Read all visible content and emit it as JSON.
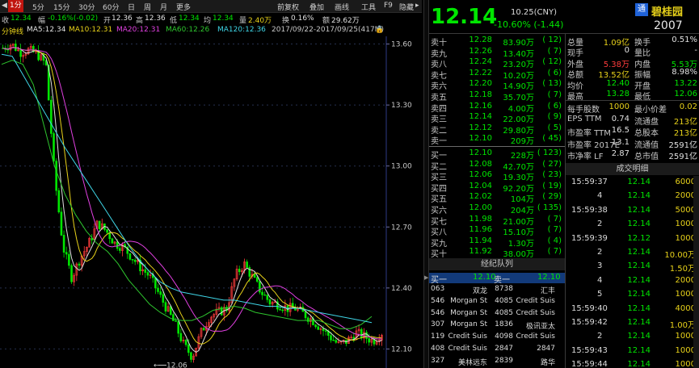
{
  "menu": {
    "items": [
      "1分",
      "5分",
      "15分",
      "30分",
      "60分",
      "日",
      "周",
      "月",
      "更多"
    ],
    "active_index": 0,
    "right_items": [
      "前复权",
      "叠加",
      "画线",
      "工具",
      "F9",
      "隐藏"
    ]
  },
  "info": {
    "close_label": "收",
    "close_value": "12.34",
    "change_label": "幅",
    "change_value": "-0.16%(-0.02)",
    "open_label": "开",
    "open_value": "12.36",
    "high_label": "高",
    "high_value": "12.36",
    "low_label": "低",
    "low_value": "12.34",
    "avg_label": "均",
    "avg_value": "12.34",
    "vol_label": "量",
    "vol_value": "2.40万",
    "turn_label": "换",
    "turn_value": "0.16%",
    "amt_label": "额",
    "amt_value": "29.62万"
  },
  "ma": {
    "title": "分钟线",
    "ma5": "MA5:12.34",
    "ma10": "MA10:12.31",
    "ma20": "MA20:12.31",
    "ma60": "MA60:12.26",
    "ma120": "MA120:12.36",
    "range": "2017/09/22-2017/09/25(417M)"
  },
  "colors": {
    "ma5": "#e0e0e0",
    "ma10": "#e8d21a",
    "ma20": "#e040e0",
    "ma60": "#2ec52e",
    "ma120": "#3fd5e6",
    "up": "#ff3c3c",
    "down": "#00e600"
  },
  "chart_data": {
    "type": "candlestick",
    "timeframe": "1分",
    "y_ticks": [
      "13.60",
      "13.30",
      "13.00",
      "12.70",
      "12.40",
      "12.10"
    ],
    "ylim": [
      12.05,
      13.63
    ],
    "low_annotation": "12.06",
    "low_value": 12.06,
    "approx_close_series": [
      13.58,
      13.6,
      13.56,
      13.57,
      13.55,
      13.5,
      12.95,
      12.6,
      12.45,
      12.55,
      12.62,
      12.72,
      12.68,
      12.62,
      12.6,
      12.55,
      12.5,
      12.46,
      12.38,
      12.3,
      12.22,
      12.12,
      12.06,
      12.18,
      12.26,
      12.28,
      12.3,
      12.46,
      12.52,
      12.45,
      12.38,
      12.33,
      12.32,
      12.3,
      12.3,
      12.27,
      12.24,
      12.2,
      12.16,
      12.12,
      12.14,
      12.18,
      12.16,
      12.14,
      12.18
    ],
    "ma60_series": [
      13.5,
      13.52,
      13.5,
      13.4,
      13.2,
      13.0,
      12.86,
      12.76,
      12.68,
      12.62,
      12.58,
      12.52,
      12.44,
      12.38,
      12.32,
      12.28,
      12.25,
      12.24,
      12.24,
      12.26,
      12.29,
      12.3,
      12.31,
      12.3,
      12.28,
      12.27,
      12.26,
      12.25,
      12.24,
      12.24,
      12.24,
      12.22,
      12.2,
      12.2,
      12.22,
      12.26
    ],
    "ma120_series": [
      13.55,
      13.54,
      13.45,
      13.36,
      13.27,
      13.18,
      13.09,
      13.01,
      12.93,
      12.85,
      12.77,
      12.69,
      12.61,
      12.54,
      12.48,
      12.43,
      12.4,
      12.38,
      12.37,
      12.36,
      12.35,
      12.34,
      12.34,
      12.33,
      12.32,
      12.31,
      12.31,
      12.3,
      12.3,
      12.29,
      12.28,
      12.27,
      12.26,
      12.25,
      12.24,
      12.23
    ]
  },
  "quote": {
    "price": "12.14",
    "date": "10.25(CNY)",
    "change": "-10.60% (-1.44)",
    "badge": "通",
    "name": "碧桂园",
    "code": "2007"
  },
  "order_book": {
    "asks": [
      {
        "label": "卖十",
        "price": "12.28",
        "vol": "83.90万",
        "cnt": "( 12)"
      },
      {
        "label": "卖九",
        "price": "12.26",
        "vol": "13.40万",
        "cnt": "( 7)"
      },
      {
        "label": "卖八",
        "price": "12.24",
        "vol": "23.20万",
        "cnt": "( 12)"
      },
      {
        "label": "卖七",
        "price": "12.22",
        "vol": "10.20万",
        "cnt": "( 6)"
      },
      {
        "label": "卖六",
        "price": "12.20",
        "vol": "14.90万",
        "cnt": "( 13)"
      },
      {
        "label": "卖五",
        "price": "12.18",
        "vol": "35.70万",
        "cnt": "( 7)"
      },
      {
        "label": "卖四",
        "price": "12.16",
        "vol": "4.00万",
        "cnt": "( 6)"
      },
      {
        "label": "卖三",
        "price": "12.14",
        "vol": "22.00万",
        "cnt": "( 9)"
      },
      {
        "label": "卖二",
        "price": "12.12",
        "vol": "29.80万",
        "cnt": "( 5)"
      },
      {
        "label": "卖一",
        "price": "12.10",
        "vol": "209万",
        "cnt": "( 45)"
      }
    ],
    "bids": [
      {
        "label": "买一",
        "price": "12.10",
        "vol": "228万",
        "cnt": "( 123)"
      },
      {
        "label": "买二",
        "price": "12.08",
        "vol": "42.70万",
        "cnt": "( 27)"
      },
      {
        "label": "买三",
        "price": "12.06",
        "vol": "19.30万",
        "cnt": "( 23)"
      },
      {
        "label": "买四",
        "price": "12.04",
        "vol": "92.20万",
        "cnt": "( 19)"
      },
      {
        "label": "买五",
        "price": "12.02",
        "vol": "104万",
        "cnt": "( 29)"
      },
      {
        "label": "买六",
        "price": "12.00",
        "vol": "204万",
        "cnt": "( 135)"
      },
      {
        "label": "买七",
        "price": "11.98",
        "vol": "21.00万",
        "cnt": "( 7)"
      },
      {
        "label": "买八",
        "price": "11.96",
        "vol": "15.10万",
        "cnt": "( 7)"
      },
      {
        "label": "买九",
        "price": "11.94",
        "vol": "1.30万",
        "cnt": "( 4)"
      },
      {
        "label": "买十",
        "price": "11.92",
        "vol": "38.00万",
        "cnt": "( 7)"
      }
    ]
  },
  "stats": [
    {
      "l1": "总量",
      "v1": "1.09亿",
      "c1": "yellow",
      "l2": "换手",
      "v2": "0.51%",
      "c2": "white"
    },
    {
      "l1": "现手",
      "v1": "0",
      "c1": "white",
      "l2": "量比",
      "v2": "-",
      "c2": "white"
    },
    {
      "l1": "外盘",
      "v1": "5.38万",
      "c1": "red",
      "l2": "内盘",
      "v2": "5.53万",
      "c2": "green"
    },
    {
      "l1": "总额",
      "v1": "13.52亿",
      "c1": "yellow",
      "l2": "振幅",
      "v2": "8.98%",
      "c2": "white"
    },
    {
      "l1": "均价",
      "v1": "12.40",
      "c1": "green",
      "l2": "开盘",
      "v2": "13.22",
      "c2": "green"
    },
    {
      "l1": "最高",
      "v1": "13.28",
      "c1": "green",
      "l2": "最低",
      "v2": "12.06",
      "c2": "green"
    }
  ],
  "stats2": [
    {
      "l1": "每手股数",
      "v1": "1000",
      "c1": "yellow",
      "l2": "最小价差",
      "v2": "0.02",
      "c2": "yellow"
    },
    {
      "l1": "EPS TTM",
      "v1": "0.74",
      "c1": "white",
      "l2": "流通盘",
      "v2": "213亿",
      "c2": "yellow"
    },
    {
      "l1": "市盈率 TTM",
      "v1": "16.5",
      "c1": "white",
      "l2": "总股本",
      "v2": "213亿",
      "c2": "yellow"
    },
    {
      "l1": "市盈率 2017E",
      "v1": "13.1",
      "c1": "white",
      "l2": "流通值",
      "v2": "2591亿",
      "c2": "white"
    },
    {
      "l1": "市净率 LF",
      "v1": "2.87",
      "c1": "white",
      "l2": "总市值",
      "v2": "2591亿",
      "c2": "white"
    }
  ],
  "broker_title": "经纪队列",
  "broker_header": {
    "left": "买一",
    "left_price": "12.10",
    "right": "卖一",
    "right_price": "12.10"
  },
  "brokers": [
    {
      "id": "063",
      "name": "双龙",
      "num": "8738",
      "name2": "汇丰"
    },
    {
      "id": "546",
      "name": "Morgan St",
      "num": "4085",
      "name2": "Credit Suis"
    },
    {
      "id": "546",
      "name": "Morgan St",
      "num": "4085",
      "name2": "Credit Suis"
    },
    {
      "id": "307",
      "name": "Morgan St",
      "num": "1836",
      "name2": "极讯亚太"
    },
    {
      "id": "119",
      "name": "Credit Suis",
      "num": "4098",
      "name2": "Credit Suis"
    },
    {
      "id": "408",
      "name": "Credit Suis",
      "num": "2847",
      "name2": "2847"
    },
    {
      "id": "327",
      "name": "美林远东",
      "num": "2839",
      "name2": "路华"
    }
  ],
  "ticks_title": "成交明细",
  "ticks": [
    {
      "time": "15:59:37",
      "price": "12.14",
      "vol": "6000"
    },
    {
      "time": "4",
      "price": "12.14",
      "vol": "2000"
    },
    {
      "time": "15:59:38",
      "price": "12.14",
      "vol": "5000"
    },
    {
      "time": "2",
      "price": "12.14",
      "vol": "1000"
    },
    {
      "time": "15:59:39",
      "price": "12.12",
      "vol": "1000"
    },
    {
      "time": "2",
      "price": "12.14",
      "vol": "10.00万"
    },
    {
      "time": "3",
      "price": "12.14",
      "vol": "1.50万"
    },
    {
      "time": "4",
      "price": "12.14",
      "vol": "2000"
    },
    {
      "time": "5",
      "price": "12.14",
      "vol": "1000"
    },
    {
      "time": "15:59:40",
      "price": "12.14",
      "vol": "4000"
    },
    {
      "time": "15:59:42",
      "price": "12.14",
      "vol": "1.00万"
    },
    {
      "time": "2",
      "price": "12.14",
      "vol": "1000"
    },
    {
      "time": "15:59:43",
      "price": "12.14",
      "vol": "1000"
    },
    {
      "time": "15:59:44",
      "price": "12.14",
      "vol": "1000"
    }
  ]
}
